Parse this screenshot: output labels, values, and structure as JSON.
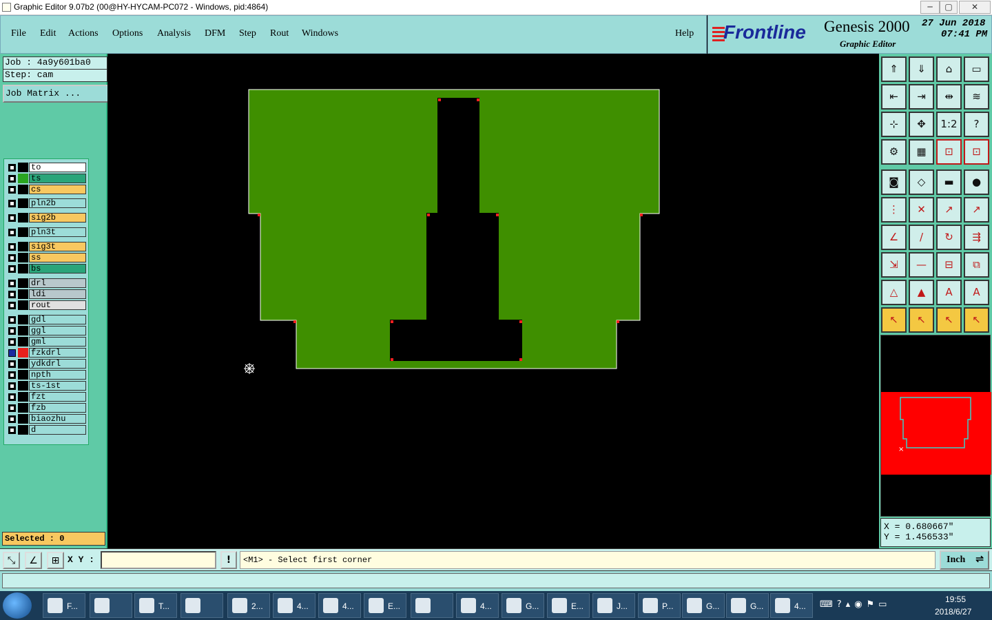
{
  "window": {
    "title": "Graphic Editor 9.07b2 (00@HY-HYCAM-PC072 - Windows, pid:4864)"
  },
  "menu": [
    "File",
    "Edit",
    "Actions",
    "Options",
    "Analysis",
    "DFM",
    "Step",
    "Rout",
    "Windows"
  ],
  "help_label": "Help",
  "brand": {
    "logo": "Frontline",
    "product": "Genesis 2000",
    "module": "Graphic Editor",
    "date": "27 Jun 2018",
    "time": "07:41 PM"
  },
  "job": {
    "job_label": "Job : 4a9y601ba0",
    "step_label": "Step: cam",
    "matrix_button": "Job Matrix ..."
  },
  "layers": [
    {
      "name": "to",
      "color": "#ffffff",
      "swatch": "#000000"
    },
    {
      "name": "ts",
      "color": "#2aa57a",
      "swatch": "#2aa520"
    },
    {
      "name": "cs",
      "color": "#f8c860",
      "swatch": "#000000"
    },
    {
      "name": "pln2b",
      "color": "#9cdcd8",
      "swatch": "#000000"
    },
    {
      "name": "sig2b",
      "color": "#f8c860",
      "swatch": "#000000"
    },
    {
      "name": "pln3t",
      "color": "#9cdcd8",
      "swatch": "#000000"
    },
    {
      "name": "sig3t",
      "color": "#f8c860",
      "swatch": "#000000"
    },
    {
      "name": "ss",
      "color": "#f8c860",
      "swatch": "#000000"
    },
    {
      "name": "bs",
      "color": "#2aa57a",
      "swatch": "#000000"
    },
    {
      "name": "drl",
      "color": "#b8c8cc",
      "swatch": "#000000"
    },
    {
      "name": "ldi",
      "color": "#b8c8cc",
      "swatch": "#000000"
    },
    {
      "name": "rout",
      "color": "#e0e0e0",
      "swatch": "#000000"
    },
    {
      "name": "gdl",
      "color": "#9cdcd8",
      "swatch": "#000000"
    },
    {
      "name": "ggl",
      "color": "#9cdcd8",
      "swatch": "#000000"
    },
    {
      "name": "gml",
      "color": "#9cdcd8",
      "swatch": "#000000"
    },
    {
      "name": "fzkdrl",
      "color": "#9cdcd8",
      "swatch": "#e8201c"
    },
    {
      "name": "ydkdrl",
      "color": "#9cdcd8",
      "swatch": "#000000"
    },
    {
      "name": "npth",
      "color": "#9cdcd8",
      "swatch": "#000000"
    },
    {
      "name": "ts-1st",
      "color": "#9cdcd8",
      "swatch": "#000000"
    },
    {
      "name": "fzt",
      "color": "#9cdcd8",
      "swatch": "#000000"
    },
    {
      "name": "fzb",
      "color": "#9cdcd8",
      "swatch": "#000000"
    },
    {
      "name": "biaozhu",
      "color": "#9cdcd8",
      "swatch": "#000000"
    },
    {
      "name": "d",
      "color": "#9cdcd8",
      "swatch": "#000000"
    }
  ],
  "selected_label": "Selected : 0",
  "coords": {
    "x": "X = 0.680667\"",
    "y": "Y = 1.456533\""
  },
  "command": {
    "xy_label": "X Y :",
    "xy_value": "",
    "message": "<M1> - Select first corner",
    "units": "Inch"
  },
  "colors": {
    "board": "#3f8f00",
    "panel": "#9cdcd8",
    "preview_fill": "#ff0000",
    "preview_outline": "#3cd0c8"
  },
  "taskbar": {
    "items": [
      {
        "label": "F...",
        "icon": "foxit-icon"
      },
      {
        "label": "",
        "icon": "ie-icon"
      },
      {
        "label": "T...",
        "icon": "disk-icon"
      },
      {
        "label": "",
        "icon": "shell-icon"
      },
      {
        "label": "2...",
        "icon": "word-icon"
      },
      {
        "label": "4...",
        "icon": "excel-icon"
      },
      {
        "label": "4...",
        "icon": "excel-icon"
      },
      {
        "label": "E...",
        "icon": "frontline-icon"
      },
      {
        "label": "",
        "icon": "bird-icon"
      },
      {
        "label": "4...",
        "icon": "pdf-icon"
      },
      {
        "label": "G...",
        "icon": "eye-icon"
      },
      {
        "label": "E...",
        "icon": "xwin-icon"
      },
      {
        "label": "J...",
        "icon": "xwin-icon"
      },
      {
        "label": "P...",
        "icon": "xwin-icon"
      },
      {
        "label": "G...",
        "icon": "xwin-icon"
      },
      {
        "label": "G...",
        "icon": "xwin-icon"
      },
      {
        "label": "4...",
        "icon": "doc-icon"
      }
    ],
    "time": "19:55",
    "date": "2018/6/27"
  }
}
